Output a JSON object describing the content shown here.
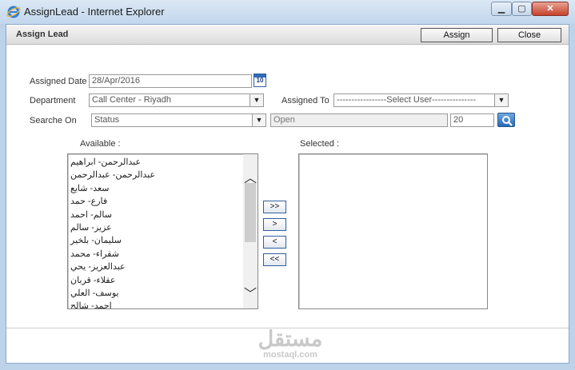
{
  "window": {
    "title": "AssignLead - Internet Explorer",
    "icon": "ie-icon"
  },
  "header": {
    "title": "Assign Lead",
    "assign_label": "Assign",
    "close_label": "Close"
  },
  "form": {
    "assigned_date_label": "Assigned Date",
    "assigned_date_value": "28/Apr/2016",
    "calendar_day": "10",
    "department_label": "Department",
    "department_value": "Call Center - Riyadh",
    "assigned_to_label": "Assigned To",
    "assigned_to_value": "-----------------Select User---------------",
    "search_on_label": "Searche On",
    "search_on_value": "Status",
    "status_value": "Open",
    "count_value": "20"
  },
  "lists": {
    "available_label": "Available :",
    "selected_label": "Selected :",
    "available_items": [
      "عبدالرحمن- ابراهيم",
      "عبدالرحمن- عبدالرحمن",
      "سعد- شايع",
      "فارع- حمد",
      "سالم- احمد",
      "عزيز- سالم",
      "سليمان- بلخير",
      "شقراء- محمد",
      "عبدالعزيز- يحي",
      "عقلاء- قربان",
      "يوسف- العلي",
      "احمد- شالح"
    ],
    "selected_items": [],
    "move_all_right": ">>",
    "move_right": ">",
    "move_left": "<",
    "move_all_left": "<<"
  },
  "watermark": {
    "ar": "مستقل",
    "en": "mostaql.com"
  }
}
